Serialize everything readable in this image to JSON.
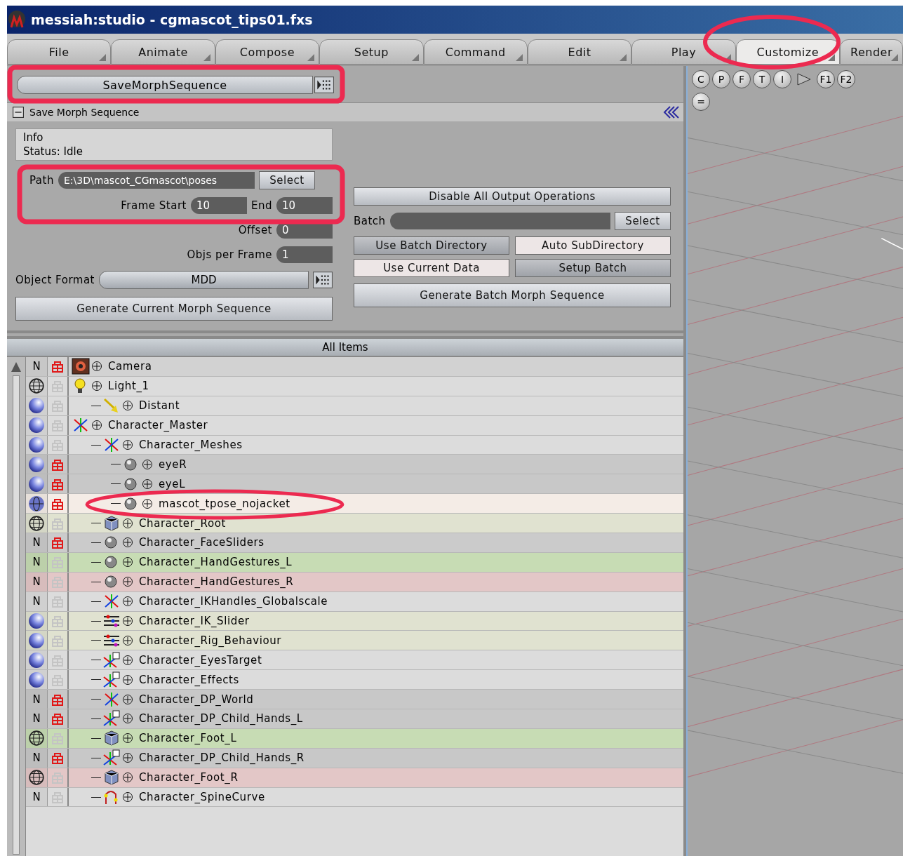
{
  "window": {
    "title": "messiah:studio - cgmascot_tips01.fxs"
  },
  "tabs": [
    {
      "label": "File",
      "selected": false
    },
    {
      "label": "Animate",
      "selected": false
    },
    {
      "label": "Compose",
      "selected": false
    },
    {
      "label": "Setup",
      "selected": false
    },
    {
      "label": "Command",
      "selected": false
    },
    {
      "label": "Edit",
      "selected": false
    },
    {
      "label": "Play",
      "selected": false
    },
    {
      "label": "Customize",
      "selected": true
    },
    {
      "label": "Render",
      "selected": false
    }
  ],
  "command_selector": {
    "value": "SaveMorphSequence"
  },
  "panel": {
    "title": "Save Morph Sequence",
    "expanded": true,
    "info": {
      "heading": "Info",
      "status": "Status: Idle"
    },
    "path": {
      "label": "Path",
      "value": "E:\\3D\\mascot_CGmascot\\poses",
      "button": "Select"
    },
    "frame_start": {
      "label": "Frame Start",
      "value": "10"
    },
    "frame_end": {
      "label": "End",
      "value": "10"
    },
    "offset": {
      "label": "Offset",
      "value": "0"
    },
    "objs_per_frame": {
      "label": "Objs per Frame",
      "value": "1"
    },
    "object_format": {
      "label": "Object Format",
      "value": "MDD"
    },
    "generate_current": "Generate Current Morph Sequence",
    "disable_output": "Disable All Output Operations",
    "batch": {
      "label": "Batch",
      "button": "Select"
    },
    "toggles": [
      {
        "label": "Use Batch Directory",
        "on": false
      },
      {
        "label": "Auto SubDirectory",
        "on": true
      },
      {
        "label": "Use Current Data",
        "on": true
      },
      {
        "label": "Setup Batch",
        "on": false
      }
    ],
    "generate_batch": "Generate Batch Morph Sequence"
  },
  "items": {
    "header": "All Items",
    "rows": [
      {
        "display": {
          "kind": "text",
          "label": "N"
        },
        "locked": true,
        "kind": "camera",
        "name": "Camera",
        "color": "#d2d2d2"
      },
      {
        "display": {
          "kind": "wire"
        },
        "locked": false,
        "kind": "bulb",
        "name": "Light_1",
        "color": "#dcdcdc",
        "children": [
          {
            "display": {
              "kind": "sphere"
            },
            "locked": false,
            "kind": "arrow",
            "name": "Distant",
            "color": "#dcdcdc"
          }
        ]
      },
      {
        "display": {
          "kind": "sphere"
        },
        "locked": false,
        "kind": "axes",
        "name": "Character_Master",
        "color": "#dcdcdc",
        "children": [
          {
            "display": {
              "kind": "sphere"
            },
            "locked": false,
            "kind": "axes",
            "name": "Character_Meshes",
            "color": "#dcdcdc",
            "children": [
              {
                "display": {
                  "kind": "sphere"
                },
                "locked": true,
                "kind": "ball",
                "name": "eyeR",
                "color": "#c8c8c8"
              },
              {
                "display": {
                  "kind": "sphere"
                },
                "locked": true,
                "kind": "ball",
                "name": "eyeL",
                "color": "#c8c8c8"
              },
              {
                "display": {
                  "kind": "mixed"
                },
                "locked": true,
                "kind": "ball",
                "name": "mascot_tpose_nojacket",
                "color": "#f4ece6"
              }
            ]
          },
          {
            "display": {
              "kind": "wire"
            },
            "locked": false,
            "kind": "cube",
            "name": "Character_Root",
            "color": "#e0e2d0"
          },
          {
            "display": {
              "kind": "text",
              "label": "N"
            },
            "locked": true,
            "kind": "ball",
            "name": "Character_FaceSliders",
            "color": "#cbcbcb"
          },
          {
            "display": {
              "kind": "text",
              "label": "N"
            },
            "locked": false,
            "kind": "ball",
            "name": "Character_HandGestures_L",
            "color": "#c7dcb4"
          },
          {
            "display": {
              "kind": "text",
              "label": "N"
            },
            "locked": false,
            "kind": "ball",
            "name": "Character_HandGestures_R",
            "color": "#e3c7c7"
          },
          {
            "display": {
              "kind": "text",
              "label": "N"
            },
            "locked": false,
            "kind": "axes",
            "name": "Character_IKHandles_Globalscale",
            "color": "#dcdcdc"
          },
          {
            "display": {
              "kind": "sphere"
            },
            "locked": false,
            "kind": "sliders",
            "name": "Character_IK_Slider",
            "color": "#e0e2d0"
          },
          {
            "display": {
              "kind": "sphere"
            },
            "locked": false,
            "kind": "sliders",
            "name": "Character_Rig_Behaviour",
            "color": "#e0e2d0"
          },
          {
            "display": {
              "kind": "sphere"
            },
            "locked": false,
            "kind": "axesbox",
            "name": "Character_EyesTarget",
            "color": "#dcdcdc"
          },
          {
            "display": {
              "kind": "sphere"
            },
            "locked": false,
            "kind": "axesbox",
            "name": "Character_Effects",
            "color": "#dcdcdc"
          },
          {
            "display": {
              "kind": "text",
              "label": "N"
            },
            "locked": true,
            "kind": "axes",
            "name": "Character_DP_World",
            "color": "#c8c8c8"
          },
          {
            "display": {
              "kind": "text",
              "label": "N"
            },
            "locked": true,
            "kind": "axesbox",
            "name": "Character_DP_Child_Hands_L",
            "color": "#c8c8c8"
          },
          {
            "display": {
              "kind": "wire"
            },
            "locked": false,
            "kind": "cube",
            "name": "Character_Foot_L",
            "color": "#c7dcb4"
          },
          {
            "display": {
              "kind": "text",
              "label": "N"
            },
            "locked": true,
            "kind": "axesbox",
            "name": "Character_DP_Child_Hands_R",
            "color": "#c8c8c8"
          },
          {
            "display": {
              "kind": "wire"
            },
            "locked": false,
            "kind": "cube",
            "name": "Character_Foot_R",
            "color": "#e3c7c7"
          },
          {
            "display": {
              "kind": "text",
              "label": "N"
            },
            "locked": false,
            "kind": "curve",
            "name": "Character_SpineCurve",
            "color": "#dcdcdc"
          }
        ]
      }
    ]
  },
  "viewport": {
    "view_buttons": [
      "C",
      "P",
      "F",
      "T",
      "I"
    ],
    "function_buttons": [
      "F1",
      "F2"
    ],
    "menu_button": "="
  }
}
